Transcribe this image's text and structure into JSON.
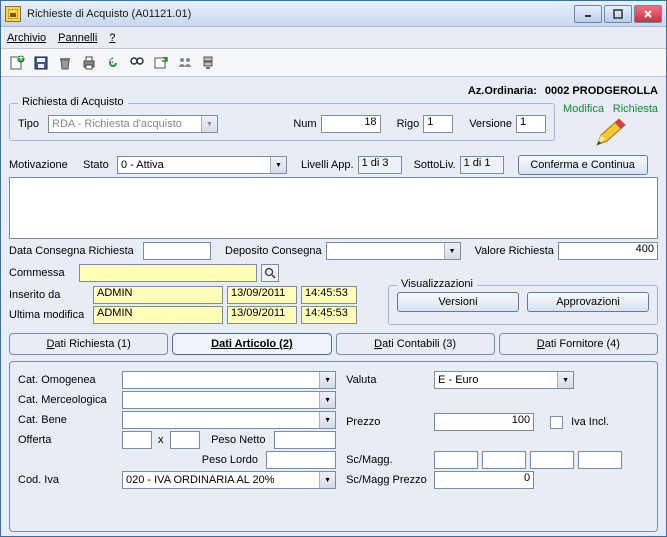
{
  "window": {
    "title": "Richieste di Acquisto (A01121.01)"
  },
  "menu": {
    "archivio": "Archivio",
    "pannelli": "Pannelli",
    "help": "?"
  },
  "header": {
    "az_label": "Az.Ordinaria:",
    "az_value": "0002 PRODGEROLLA",
    "modifica": "Modifica",
    "richiesta": "Richiesta"
  },
  "group1": {
    "title": "Richiesta di Acquisto"
  },
  "tipo": {
    "label": "Tipo",
    "value": "RDA - Richiesta d'acquisto"
  },
  "num": {
    "label": "Num",
    "value": "18"
  },
  "rigo": {
    "label": "Rigo",
    "value": "1"
  },
  "versione": {
    "label": "Versione",
    "value": "1"
  },
  "motivazione": {
    "label": "Motivazione"
  },
  "stato": {
    "label": "Stato",
    "value": "0 - Attiva"
  },
  "livelli": {
    "label": "Livelli App.",
    "value": "1 di 3"
  },
  "sottoliv": {
    "label": "SottoLiv.",
    "value": "1 di 1"
  },
  "conferma_btn": "Conferma e Continua",
  "dcr": {
    "label": "Data Consegna Richiesta"
  },
  "dep": {
    "label": "Deposito Consegna"
  },
  "valr": {
    "label": "Valore Richiesta",
    "value": "400"
  },
  "commessa": {
    "label": "Commessa"
  },
  "inserito": {
    "label": "Inserito da",
    "user": "ADMIN",
    "date": "13/09/2011",
    "time": "14:45:53"
  },
  "ultima": {
    "label": "Ultima modifica",
    "user": "ADMIN",
    "date": "13/09/2011",
    "time": "14:45:53"
  },
  "viz": {
    "title": "Visualizzazioni",
    "versioni": "Versioni",
    "approvazioni": "Approvazioni"
  },
  "tabs": {
    "t1": "Dati Richiesta (1)",
    "t2": "Dati Articolo (2)",
    "t3": "Dati Contabili (3)",
    "t4": "Dati Fornitore (4)"
  },
  "art": {
    "catom": "Cat. Omogenea",
    "catmerc": "Cat. Merceologica",
    "catbene": "Cat. Bene",
    "offerta": "Offerta",
    "x": "x",
    "peson": "Peso Netto",
    "pesol": "Peso Lordo",
    "codiva": "Cod. Iva",
    "codiva_val": "020 - IVA ORDINARIA AL 20%",
    "valuta": "Valuta",
    "valuta_val": "E - Euro",
    "prezzo": "Prezzo",
    "prezzo_val": "100",
    "ivaincl": "Iva Incl.",
    "scmagg": "Sc/Magg.",
    "scmaggp": "Sc/Magg Prezzo",
    "scmaggp_val": "0"
  }
}
